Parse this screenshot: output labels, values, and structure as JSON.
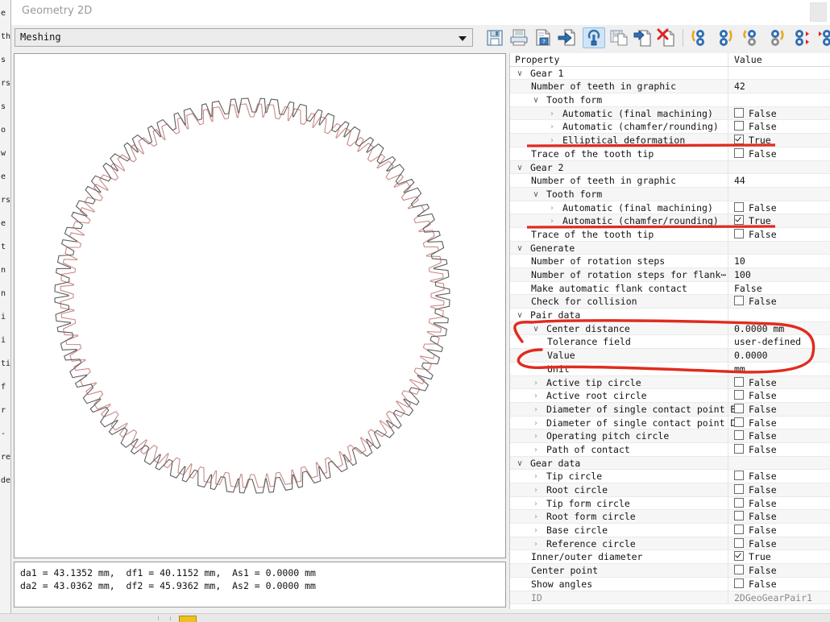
{
  "window": {
    "title": "Geometry 2D"
  },
  "background_fragment": {
    "lines": [
      "e",
      "th",
      "s",
      "rs",
      "s",
      "o",
      "w",
      "e",
      "rs",
      "e",
      "t",
      "n",
      "n",
      "i",
      "i",
      "ti",
      "f",
      "r",
      "-",
      "re",
      "de"
    ]
  },
  "toolbar": {
    "mode_select": {
      "value": "Meshing",
      "arrow_icon": "chevron-down-icon"
    },
    "buttons": [
      {
        "name": "save-button",
        "icon": "floppy-disk-icon",
        "selected": false
      },
      {
        "name": "print-button",
        "icon": "printer-icon",
        "selected": false
      },
      {
        "name": "print-preview-button",
        "icon": "document-lock-icon",
        "selected": false
      },
      {
        "name": "export-button",
        "icon": "document-arrow-in-icon",
        "selected": false
      },
      {
        "name": "settings-button",
        "icon": "wrench-document-icon",
        "selected": true
      },
      {
        "name": "save-as-button",
        "icon": "floppy-document-icon",
        "selected": false
      },
      {
        "name": "import-button",
        "icon": "document-arrow-out-icon",
        "selected": false
      },
      {
        "name": "delete-button",
        "icon": "document-delete-icon",
        "selected": false
      },
      {
        "name": "rotate-gears-left-button",
        "icon": "gears-rotate-left-icon",
        "selected": false
      },
      {
        "name": "rotate-gears-right-button",
        "icon": "gears-rotate-right-icon",
        "selected": false
      },
      {
        "name": "rotate-gear1-button",
        "icon": "gear-rotate-single-icon",
        "selected": false
      },
      {
        "name": "rotate-gear2-button",
        "icon": "gear-rotate-pair-icon",
        "selected": false
      },
      {
        "name": "gears-step-out-button",
        "icon": "gears-arrows-out-icon",
        "selected": false
      },
      {
        "name": "gears-step-in-button",
        "icon": "gears-arrows-in-icon",
        "selected": false
      }
    ]
  },
  "graphics": {
    "gear1": {
      "teeth": 42,
      "color": "#5d5d5d",
      "label": "gear-1-outline"
    },
    "gear2": {
      "teeth": 44,
      "color": "#c98a86",
      "label": "gear-2-outline"
    }
  },
  "status": {
    "line1": "da1 = 43.1352 mm,  df1 = 40.1152 mm,  As1 = 0.0000 mm",
    "line2": "da2 = 43.0362 mm,  df2 = 45.9362 mm,  As2 = 0.0000 mm"
  },
  "property_grid": {
    "headers": {
      "property": "Property",
      "value": "Value"
    },
    "rows": [
      {
        "label": "Gear 1",
        "indent": 0,
        "expander": "down",
        "value": "",
        "kind": "group"
      },
      {
        "label": "Number of teeth in graphic",
        "indent": 1,
        "expander": "none",
        "value": "42",
        "kind": "text"
      },
      {
        "label": "Tooth form",
        "indent": 1,
        "expander": "down",
        "value": "",
        "kind": "group"
      },
      {
        "label": "Automatic (final machining)",
        "indent": 2,
        "expander": "right",
        "value": "False",
        "kind": "check",
        "checked": false
      },
      {
        "label": "Automatic (chamfer/rounding)",
        "indent": 2,
        "expander": "right",
        "value": "False",
        "kind": "check",
        "checked": false
      },
      {
        "label": "Elliptical deformation",
        "indent": 2,
        "expander": "right",
        "value": "True",
        "kind": "check",
        "checked": true
      },
      {
        "label": "Trace of the tooth tip",
        "indent": 1,
        "expander": "none",
        "value": "False",
        "kind": "check",
        "checked": false
      },
      {
        "label": "Gear 2",
        "indent": 0,
        "expander": "down",
        "value": "",
        "kind": "group"
      },
      {
        "label": "Number of teeth in graphic",
        "indent": 1,
        "expander": "none",
        "value": "44",
        "kind": "text"
      },
      {
        "label": "Tooth form",
        "indent": 1,
        "expander": "down",
        "value": "",
        "kind": "group"
      },
      {
        "label": "Automatic (final machining)",
        "indent": 2,
        "expander": "right",
        "value": "False",
        "kind": "check",
        "checked": false
      },
      {
        "label": "Automatic (chamfer/rounding)",
        "indent": 2,
        "expander": "right",
        "value": "True",
        "kind": "check",
        "checked": true
      },
      {
        "label": "Trace of the tooth tip",
        "indent": 1,
        "expander": "none",
        "value": "False",
        "kind": "check",
        "checked": false
      },
      {
        "label": "Generate",
        "indent": 0,
        "expander": "down",
        "value": "",
        "kind": "group"
      },
      {
        "label": "Number of rotation steps",
        "indent": 1,
        "expander": "none",
        "value": "10",
        "kind": "text"
      },
      {
        "label": "Number of rotation steps for flank⋯",
        "indent": 1,
        "expander": "none",
        "value": "100",
        "kind": "text"
      },
      {
        "label": "Make automatic flank contact",
        "indent": 1,
        "expander": "none",
        "value": "False",
        "kind": "text"
      },
      {
        "label": "Check for collision",
        "indent": 1,
        "expander": "none",
        "value": "False",
        "kind": "check",
        "checked": false
      },
      {
        "label": "Pair data",
        "indent": 0,
        "expander": "down",
        "value": "",
        "kind": "group"
      },
      {
        "label": "Center distance",
        "indent": 1,
        "expander": "down",
        "value": "0.0000 mm",
        "kind": "text"
      },
      {
        "label": "Tolerance field",
        "indent": 2,
        "expander": "none",
        "value": "user-defined",
        "kind": "text"
      },
      {
        "label": "Value",
        "indent": 2,
        "expander": "none",
        "value": "0.0000",
        "kind": "text"
      },
      {
        "label": "Unit",
        "indent": 2,
        "expander": "none",
        "value": "mm",
        "kind": "text"
      },
      {
        "label": "Active tip circle",
        "indent": 1,
        "expander": "right",
        "value": "False",
        "kind": "check",
        "checked": false
      },
      {
        "label": "Active root circle",
        "indent": 1,
        "expander": "right",
        "value": "False",
        "kind": "check",
        "checked": false
      },
      {
        "label": "Diameter of single contact point B",
        "indent": 1,
        "expander": "right",
        "value": "False",
        "kind": "check",
        "checked": false
      },
      {
        "label": "Diameter of single contact point D",
        "indent": 1,
        "expander": "right",
        "value": "False",
        "kind": "check",
        "checked": false
      },
      {
        "label": "Operating pitch circle",
        "indent": 1,
        "expander": "right",
        "value": "False",
        "kind": "check",
        "checked": false
      },
      {
        "label": "Path of contact",
        "indent": 1,
        "expander": "right",
        "value": "False",
        "kind": "check",
        "checked": false
      },
      {
        "label": "Gear data",
        "indent": 0,
        "expander": "down",
        "value": "",
        "kind": "group"
      },
      {
        "label": "Tip circle",
        "indent": 1,
        "expander": "right",
        "value": "False",
        "kind": "check",
        "checked": false
      },
      {
        "label": "Root circle",
        "indent": 1,
        "expander": "right",
        "value": "False",
        "kind": "check",
        "checked": false
      },
      {
        "label": "Tip form circle",
        "indent": 1,
        "expander": "right",
        "value": "False",
        "kind": "check",
        "checked": false
      },
      {
        "label": "Root form circle",
        "indent": 1,
        "expander": "right",
        "value": "False",
        "kind": "check",
        "checked": false
      },
      {
        "label": "Base circle",
        "indent": 1,
        "expander": "right",
        "value": "False",
        "kind": "check",
        "checked": false
      },
      {
        "label": "Reference circle",
        "indent": 1,
        "expander": "right",
        "value": "False",
        "kind": "check",
        "checked": false
      },
      {
        "label": "Inner/outer diameter",
        "indent": 1,
        "expander": "none",
        "value": "True",
        "kind": "check",
        "checked": true
      },
      {
        "label": "Center point",
        "indent": 1,
        "expander": "none",
        "value": "False",
        "kind": "check",
        "checked": false
      },
      {
        "label": "Show angles",
        "indent": 1,
        "expander": "none",
        "value": "False",
        "kind": "check",
        "checked": false
      },
      {
        "label": "ID",
        "indent": 1,
        "expander": "none",
        "value": "2DGeoGearPair1",
        "kind": "disabled"
      }
    ]
  },
  "annotations": {
    "color": "#e02b20",
    "marks": [
      {
        "name": "underline-elliptical-deformation",
        "type": "line"
      },
      {
        "name": "underline-automatic-chamfer-rounding",
        "type": "line"
      },
      {
        "name": "ellipse-center-distance-block",
        "type": "ellipse"
      }
    ]
  }
}
